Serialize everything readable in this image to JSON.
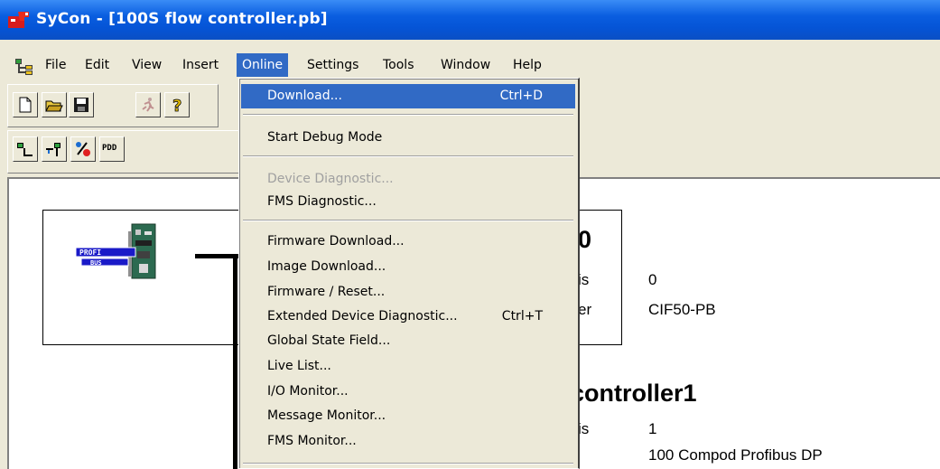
{
  "window": {
    "title": "SyCon - [100S flow controller.pb]"
  },
  "menubar": {
    "items": [
      {
        "label": "File"
      },
      {
        "label": "Edit"
      },
      {
        "label": "View"
      },
      {
        "label": "Insert"
      },
      {
        "label": "Online",
        "active": true
      },
      {
        "label": "Settings"
      },
      {
        "label": "Tools"
      },
      {
        "label": "Window"
      },
      {
        "label": "Help"
      }
    ]
  },
  "toolbar2": {
    "pdd_label": "PDD"
  },
  "online_menu": {
    "items": [
      {
        "label": "Download...",
        "shortcut": "Ctrl+D",
        "selected": true
      },
      {
        "label": "Start Debug Mode"
      },
      {
        "label": "Device Diagnostic...",
        "disabled": true
      },
      {
        "label": "FMS Diagnostic..."
      },
      {
        "label": "Firmware Download..."
      },
      {
        "label": "Image Download..."
      },
      {
        "label": "Firmware / Reset..."
      },
      {
        "label": "Extended Device Diagnostic...",
        "shortcut": "Ctrl+T"
      },
      {
        "label": "Global State Field..."
      },
      {
        "label": "Live List..."
      },
      {
        "label": "I/O Monitor..."
      },
      {
        "label": "Message Monitor..."
      },
      {
        "label": "FMS Monitor..."
      }
    ]
  },
  "devices": {
    "master": {
      "title_fragment": "0",
      "label1_fragment": "is",
      "value1": "0",
      "label2_fragment": "er",
      "value2": "CIF50-PB"
    },
    "slave": {
      "title_fragment": "controller1",
      "label1_fragment": "is",
      "value1": "1",
      "value2": "100 Compod Profibus DP"
    }
  }
}
